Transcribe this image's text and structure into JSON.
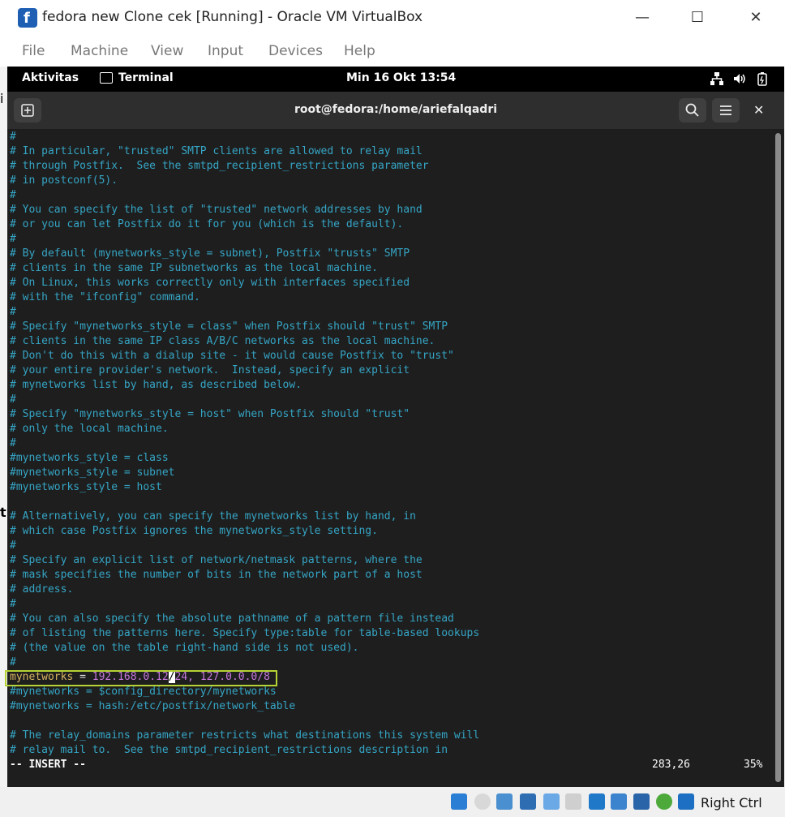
{
  "window": {
    "title": "fedora new Clone cek [Running] - Oracle VM VirtualBox",
    "minimize": "—",
    "maximize": "☐",
    "close": "✕"
  },
  "menubar": [
    "File",
    "Machine",
    "View",
    "Input",
    "Devices",
    "Help"
  ],
  "gnome_topbar": {
    "activities": "Aktivitas",
    "app": "Terminal",
    "clock": "Min 16 Okt  13:54"
  },
  "terminal": {
    "title": "root@fedora:/home/ariefalqadri",
    "lines": [
      "#",
      "# In particular, \"trusted\" SMTP clients are allowed to relay mail",
      "# through Postfix.  See the smtpd_recipient_restrictions parameter",
      "# in postconf(5).",
      "#",
      "# You can specify the list of \"trusted\" network addresses by hand",
      "# or you can let Postfix do it for you (which is the default).",
      "#",
      "# By default (mynetworks_style = subnet), Postfix \"trusts\" SMTP",
      "# clients in the same IP subnetworks as the local machine.",
      "# On Linux, this works correctly only with interfaces specified",
      "# with the \"ifconfig\" command.",
      "#",
      "# Specify \"mynetworks_style = class\" when Postfix should \"trust\" SMTP",
      "# clients in the same IP class A/B/C networks as the local machine.",
      "# Don't do this with a dialup site - it would cause Postfix to \"trust\"",
      "# your entire provider's network.  Instead, specify an explicit",
      "# mynetworks list by hand, as described below.",
      "#",
      "# Specify \"mynetworks_style = host\" when Postfix should \"trust\"",
      "# only the local machine.",
      "#",
      "#mynetworks_style = class",
      "#mynetworks_style = subnet",
      "#mynetworks_style = host",
      "",
      "# Alternatively, you can specify the mynetworks list by hand, in",
      "# which case Postfix ignores the mynetworks_style setting.",
      "#",
      "# Specify an explicit list of network/netmask patterns, where the",
      "# mask specifies the number of bits in the network part of a host",
      "# address.",
      "#",
      "# You can also specify the absolute pathname of a pattern file instead",
      "# of listing the patterns here. Specify type:table for table-based lookups",
      "# (the value on the table right-hand side is not used).",
      "#"
    ],
    "active_line": {
      "key": "mynetworks",
      "eq": " = ",
      "value_a": "192.168.0.12",
      "cursor": "/",
      "value_b": "24, 127.0.0.0/8"
    },
    "after_lines": [
      "#mynetworks = $config_directory/mynetworks",
      "#mynetworks = hash:/etc/postfix/network_table",
      "",
      "# The relay_domains parameter restricts what destinations this system will",
      "# relay mail to.  See the smtpd_recipient_restrictions description in"
    ],
    "mode": "-- INSERT --",
    "position": "283,26",
    "percent": "35%"
  },
  "statusbar": {
    "host_key": "Right Ctrl"
  },
  "colors": {
    "comment": "#35a5c5",
    "value": "#c678dd",
    "key": "#d6b45f",
    "highlight_border": "#b5d334"
  }
}
